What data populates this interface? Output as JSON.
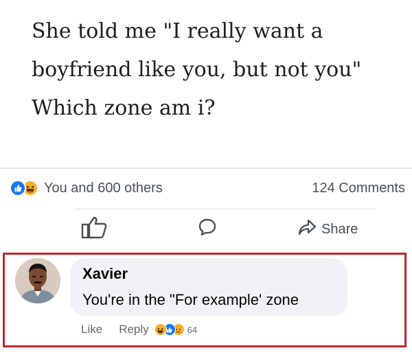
{
  "post": {
    "lines": [
      "She told me \"I really want a",
      "boyfriend like you, but not you\"",
      "Which zone am i?"
    ]
  },
  "stats": {
    "reactions_text": "You and 600 others",
    "comments_text": "124 Comments",
    "reaction_icons": [
      "like-icon",
      "haha-icon"
    ]
  },
  "actions": {
    "like_icon": "thumbs-up-icon",
    "comment_icon": "speech-bubble-icon",
    "share_label": "Share",
    "share_icon": "share-arrow-icon"
  },
  "comment": {
    "author": "Xavier",
    "text": "You're in the \"For example' zone",
    "like_label": "Like",
    "reply_label": "Reply",
    "reaction_icons": [
      "haha-icon",
      "like-icon",
      "sad-icon"
    ],
    "reaction_count": "64"
  },
  "colors": {
    "highlight_border": "#c0282d",
    "like_blue": "#1877f2",
    "haha_yellow": "#f7b125",
    "bubble_bg": "#f0f2f5"
  }
}
